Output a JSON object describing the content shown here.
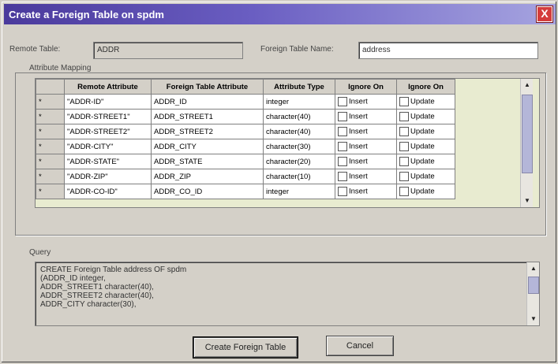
{
  "window": {
    "title": "Create a Foreign Table on spdm",
    "close_label": "X"
  },
  "form": {
    "remote_table_label": "Remote Table:",
    "remote_table_value": "ADDR",
    "foreign_table_name_label": "Foreign Table Name:",
    "foreign_table_name_value": "address"
  },
  "mapping": {
    "group_label": "Attribute Mapping",
    "columns": [
      "Remote Attribute",
      "Foreign Table Attribute",
      "Attribute Type",
      "Ignore On",
      "Ignore On"
    ],
    "rows": [
      {
        "marker": "*",
        "remote": "\"ADDR-ID\"",
        "foreign": "ADDR_ID",
        "type": "integer",
        "ignore_insert": "Insert",
        "ignore_update": "Update"
      },
      {
        "marker": "*",
        "remote": "\"ADDR-STREET1\"",
        "foreign": "ADDR_STREET1",
        "type": "character(40)",
        "ignore_insert": "Insert",
        "ignore_update": "Update"
      },
      {
        "marker": "*",
        "remote": "\"ADDR-STREET2\"",
        "foreign": "ADDR_STREET2",
        "type": "character(40)",
        "ignore_insert": "Insert",
        "ignore_update": "Update"
      },
      {
        "marker": "*",
        "remote": "\"ADDR-CITY\"",
        "foreign": "ADDR_CITY",
        "type": "character(30)",
        "ignore_insert": "Insert",
        "ignore_update": "Update"
      },
      {
        "marker": "*",
        "remote": "\"ADDR-STATE\"",
        "foreign": "ADDR_STATE",
        "type": "character(20)",
        "ignore_insert": "Insert",
        "ignore_update": "Update"
      },
      {
        "marker": "*",
        "remote": "\"ADDR-ZIP\"",
        "foreign": "ADDR_ZIP",
        "type": "character(10)",
        "ignore_insert": "Insert",
        "ignore_update": "Update"
      },
      {
        "marker": "*",
        "remote": "\"ADDR-CO-ID\"",
        "foreign": "ADDR_CO_ID",
        "type": "integer",
        "ignore_insert": "Insert",
        "ignore_update": "Update"
      }
    ]
  },
  "query": {
    "label": "Query",
    "lines": [
      "CREATE Foreign Table address OF spdm",
      "(ADDR_ID integer,",
      " ADDR_STREET1 character(40),",
      " ADDR_STREET2 character(40),",
      " ADDR_CITY character(30),"
    ]
  },
  "buttons": {
    "create": "Create Foreign Table",
    "cancel": "Cancel"
  },
  "icons": {
    "scroll_up": "scroll-up-arrow-icon",
    "scroll_down": "scroll-down-arrow-icon"
  }
}
